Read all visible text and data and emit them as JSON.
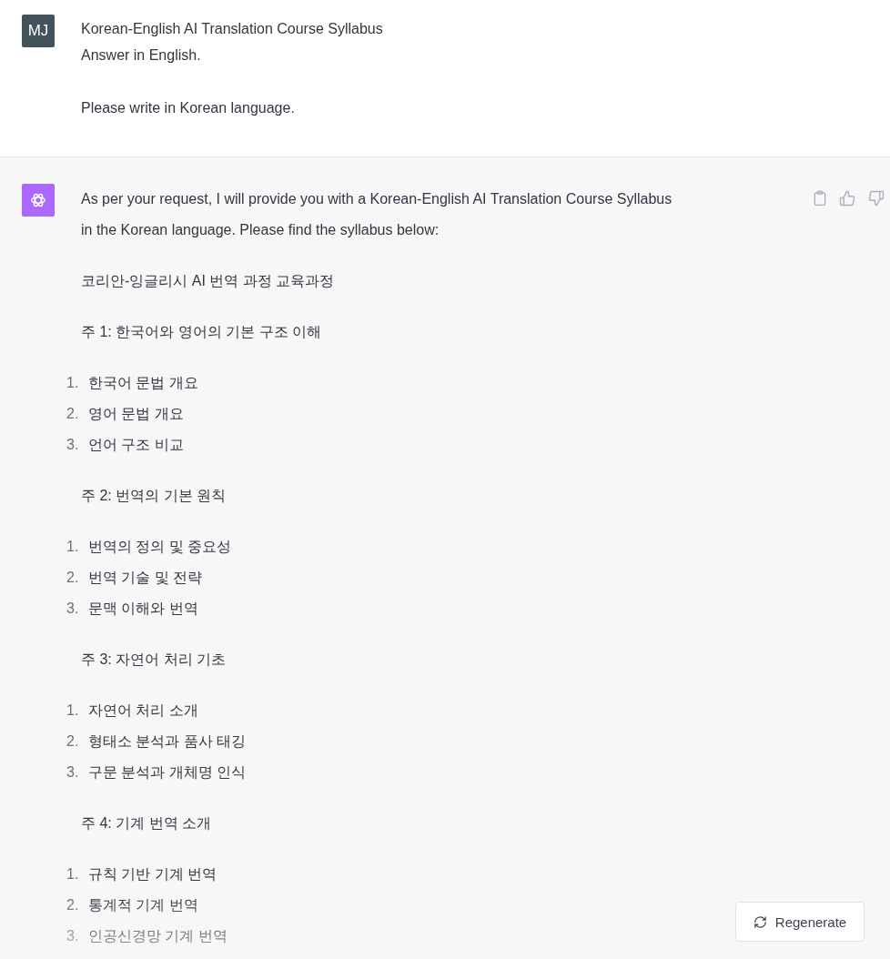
{
  "user_message": {
    "avatar": "MJ",
    "paragraphs": [
      {
        "lines": [
          "Korean-English AI Translation Course Syllabus",
          "Answer in English."
        ]
      },
      {
        "lines": [
          "Please write in Korean language."
        ]
      }
    ]
  },
  "assistant_message": {
    "blocks": [
      {
        "kind": "paragraph",
        "text": "As per your request, I will provide you with a Korean-English AI Translation Course Syllabus in the Korean language. Please find the syllabus below:"
      },
      {
        "kind": "paragraph",
        "text": "코리안-잉글리시 AI 번역 과정 교육과정"
      },
      {
        "kind": "paragraph",
        "text": "주 1: 한국어와 영어의 기본 구조 이해"
      },
      {
        "kind": "list",
        "items": [
          {
            "number": "1.",
            "text": "한국어 문법 개요"
          },
          {
            "number": "2.",
            "text": "영어 문법 개요"
          },
          {
            "number": "3.",
            "text": "언어 구조 비교"
          }
        ]
      },
      {
        "kind": "paragraph",
        "text": "주 2: 번역의 기본 원칙"
      },
      {
        "kind": "list",
        "items": [
          {
            "number": "1.",
            "text": "번역의 정의 및 중요성"
          },
          {
            "number": "2.",
            "text": "번역 기술 및 전략"
          },
          {
            "number": "3.",
            "text": "문맥 이해와 번역"
          }
        ]
      },
      {
        "kind": "paragraph",
        "text": "주 3: 자연어 처리 기초"
      },
      {
        "kind": "list",
        "items": [
          {
            "number": "1.",
            "text": "자연어 처리 소개"
          },
          {
            "number": "2.",
            "text": "형태소 분석과 품사 태깅"
          },
          {
            "number": "3.",
            "text": "구문 분석과 개체명 인식"
          }
        ]
      },
      {
        "kind": "paragraph",
        "text": "주 4: 기계 번역 소개"
      },
      {
        "kind": "list",
        "items": [
          {
            "number": "1.",
            "text": "규칙 기반 기계 번역"
          },
          {
            "number": "2.",
            "text": "통계적 기계 번역"
          },
          {
            "number": "3.",
            "text": "인공신경망 기계 번역"
          }
        ]
      }
    ]
  },
  "regenerate_button": {
    "label": "Regenerate"
  }
}
